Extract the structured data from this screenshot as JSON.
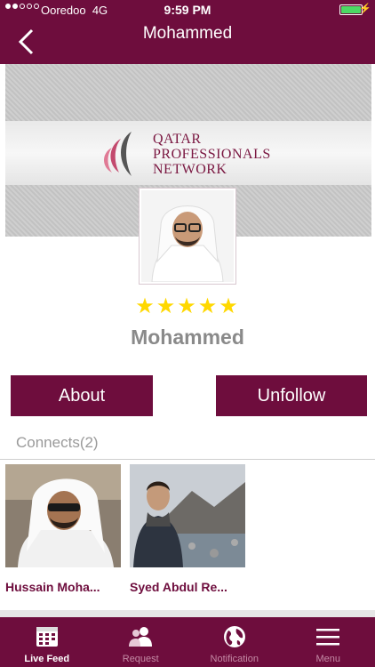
{
  "status_bar": {
    "carrier": "Ooredoo",
    "network": "4G",
    "time": "9:59 PM",
    "battery_color": "#4cd964"
  },
  "nav": {
    "title": "Mohammed",
    "back_icon": "chevron-left-icon"
  },
  "banner": {
    "brand_line1": "QATAR",
    "brand_line2": "PROFESSIONALS",
    "brand_line3": "NETWORK"
  },
  "profile": {
    "stars": "★★★★★",
    "rating": 5,
    "name": "Mohammed"
  },
  "actions": {
    "about_label": "About",
    "unfollow_label": "Unfollow"
  },
  "connects": {
    "header": "Connects(2)",
    "items": [
      {
        "name": "Hussain Moha..."
      },
      {
        "name": "Syed Abdul Re..."
      }
    ]
  },
  "tabs": [
    {
      "label": "Live Feed",
      "icon": "calendar-icon",
      "active": true
    },
    {
      "label": "Request",
      "icon": "users-icon",
      "active": false
    },
    {
      "label": "Notification",
      "icon": "globe-icon",
      "active": false
    },
    {
      "label": "Menu",
      "icon": "hamburger-icon",
      "active": false
    }
  ],
  "colors": {
    "brand": "#6e0d3d",
    "star": "#ffd800",
    "name_gray": "#8a8a8a"
  }
}
